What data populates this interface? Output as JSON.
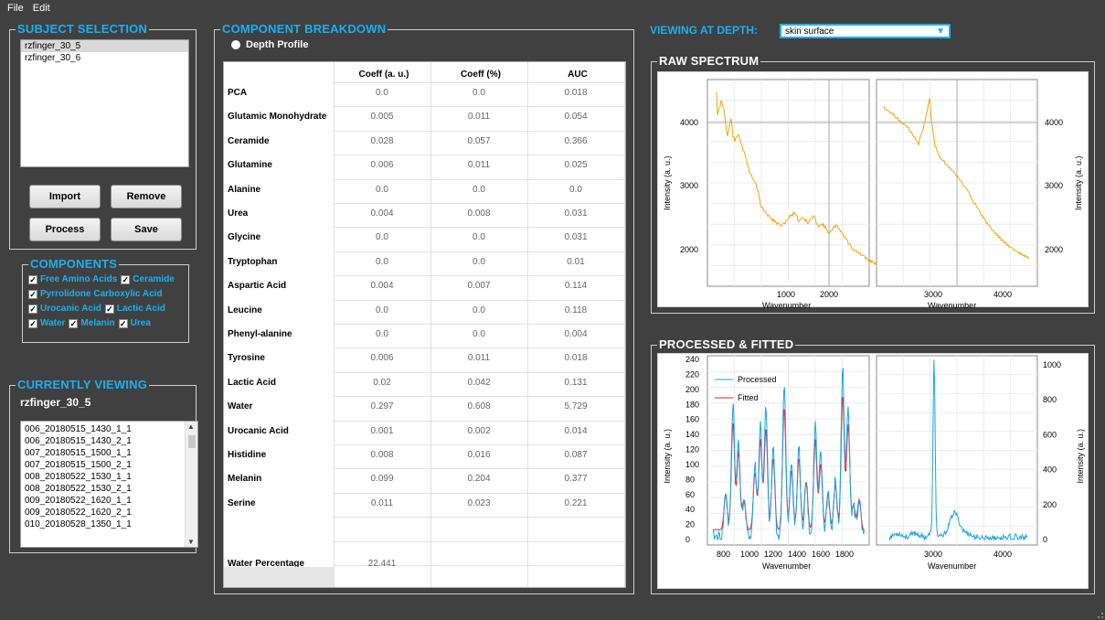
{
  "menu": {
    "file": "File",
    "edit": "Edit"
  },
  "subject": {
    "title": "SUBJECT SELECTION",
    "items": [
      "rzfinger_30_5",
      "rzfinger_30_6"
    ],
    "import": "Import",
    "remove": "Remove",
    "process": "Process",
    "save": "Save"
  },
  "components": {
    "title": "COMPONENTS",
    "items": [
      "Free Amino Acids",
      "Ceramide",
      "Pyrrolidone Carboxylic Acid",
      "Urocanic Acid",
      "Lactic Acid",
      "Water",
      "Melanin",
      "Urea"
    ],
    "checked": true
  },
  "viewing": {
    "title": "CURRENTLY VIEWING",
    "subject": "rzfinger_30_5",
    "files": [
      "006_20180515_1430_1_1",
      "006_20180515_1430_2_1",
      "007_20180515_1500_1_1",
      "007_20180515_1500_2_1",
      "008_20180522_1530_1_1",
      "008_20180522_1530_2_1",
      "009_20180522_1620_1_1",
      "009_20180522_1620_2_1",
      "010_20180528_1350_1_1"
    ]
  },
  "breakdown": {
    "title": "COMPONENT BREAKDOWN",
    "depth_profile": "Depth Profile",
    "headers": [
      "Coeff (a. u.)",
      "Coeff (%)",
      "AUC"
    ],
    "rows": [
      {
        "name": "PCA",
        "a": "0.0",
        "b": "0.0",
        "c": "0.018"
      },
      {
        "name": "Glutamic Monohydrate",
        "a": "0.005",
        "b": "0.011",
        "c": "0.054"
      },
      {
        "name": "Ceramide",
        "a": "0.028",
        "b": "0.057",
        "c": "0.366"
      },
      {
        "name": "Glutamine",
        "a": "0.006",
        "b": "0.011",
        "c": "0.025"
      },
      {
        "name": "Alanine",
        "a": "0.0",
        "b": "0.0",
        "c": "0.0"
      },
      {
        "name": "Urea",
        "a": "0.004",
        "b": "0.008",
        "c": "0.031"
      },
      {
        "name": "Glycine",
        "a": "0.0",
        "b": "0.0",
        "c": "0.031"
      },
      {
        "name": "Tryptophan",
        "a": "0.0",
        "b": "0.0",
        "c": "0.01"
      },
      {
        "name": "Aspartic Acid",
        "a": "0.004",
        "b": "0.007",
        "c": "0.114"
      },
      {
        "name": "Leucine",
        "a": "0.0",
        "b": "0.0",
        "c": "0.118"
      },
      {
        "name": "Phenyl-alanine",
        "a": "0.0",
        "b": "0.0",
        "c": "0.004"
      },
      {
        "name": "Tyrosine",
        "a": "0.006",
        "b": "0.011",
        "c": "0.018"
      },
      {
        "name": "Lactic Acid",
        "a": "0.02",
        "b": "0.042",
        "c": "0.131"
      },
      {
        "name": "Water",
        "a": "0.297",
        "b": "0.608",
        "c": "5.729"
      },
      {
        "name": "Urocanic Acid",
        "a": "0.001",
        "b": "0.002",
        "c": "0.014"
      },
      {
        "name": "Histidine",
        "a": "0.008",
        "b": "0.016",
        "c": "0.087"
      },
      {
        "name": "Melanin",
        "a": "0.099",
        "b": "0.204",
        "c": "0.377"
      },
      {
        "name": "Serine",
        "a": "0.011",
        "b": "0.023",
        "c": "0.221"
      }
    ],
    "water_label": "Water Percentage",
    "water_value": "22.441"
  },
  "depth": {
    "label": "VIEWING AT DEPTH:",
    "value": "skin surface"
  },
  "raw": {
    "title": "RAW SPECTRUM",
    "ylabel": "Intensity (a. u.)",
    "xlabel": "Wavenumber",
    "left_yticks": [
      "4000",
      "3000",
      "2000"
    ],
    "left_xticks": [
      "1000",
      "2000"
    ],
    "right_yticks": [
      "4000",
      "3000",
      "2000"
    ],
    "right_xticks": [
      "3000",
      "4000"
    ]
  },
  "fitted": {
    "title": "PROCESSED & FITTED",
    "ylabel": "Intensity (a. u.)",
    "xlabel": "Wavenumber",
    "legend": [
      "Processed",
      "Fitted"
    ],
    "left_yticks": [
      "240",
      "220",
      "200",
      "180",
      "160",
      "140",
      "120",
      "100",
      "80",
      "60",
      "40",
      "20",
      "0"
    ],
    "left_xticks": [
      "800",
      "1000",
      "1200",
      "1400",
      "1600",
      "1800"
    ],
    "right_yticks": [
      "1000",
      "800",
      "600",
      "400",
      "200",
      "0"
    ],
    "right_xticks": [
      "3000",
      "4000"
    ]
  },
  "colors": {
    "accent": "#1ab0f0",
    "raw": "#f5a30a",
    "processed": "#1aa3e8",
    "fitted": "#e0202a"
  }
}
